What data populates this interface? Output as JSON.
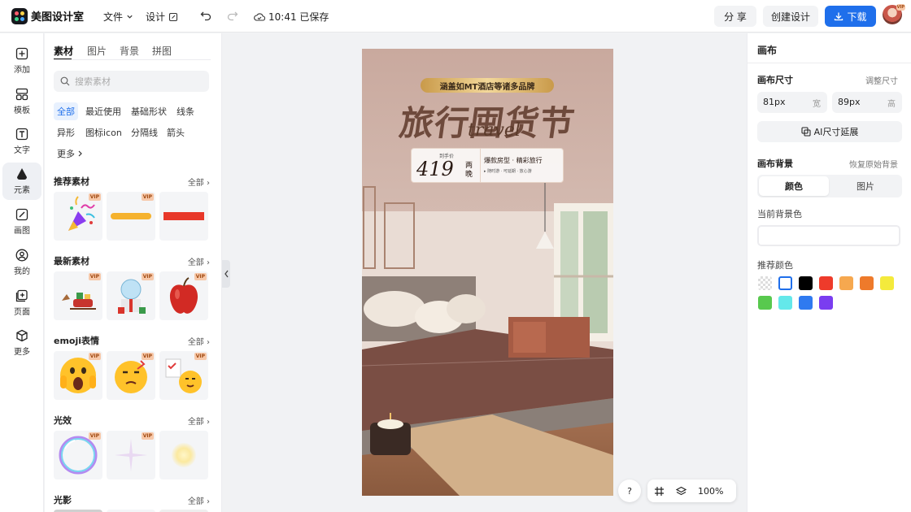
{
  "header": {
    "app_name": "美图设计室",
    "menu_file": "文件",
    "menu_design": "设计",
    "save_status": "10:41 已保存",
    "share_label": "分 享",
    "create_label": "创建设计",
    "download_label": "下载",
    "avatar_badge": "VIP",
    "accent": "#1f6feb"
  },
  "sidebar": {
    "items": [
      {
        "label": "添加",
        "icon": "plus-square-icon"
      },
      {
        "label": "模板",
        "icon": "template-icon"
      },
      {
        "label": "文字",
        "icon": "text-icon"
      },
      {
        "label": "元素",
        "icon": "shapes-icon"
      },
      {
        "label": "画图",
        "icon": "draw-icon"
      },
      {
        "label": "我的",
        "icon": "user-icon"
      },
      {
        "label": "页面",
        "icon": "page-add-icon"
      },
      {
        "label": "更多",
        "icon": "cube-icon"
      }
    ]
  },
  "panel": {
    "tabs": [
      "素材",
      "图片",
      "背景",
      "拼图"
    ],
    "search_placeholder": "搜索素材",
    "chips": [
      "全部",
      "最近使用",
      "基础形状",
      "线条",
      "异形",
      "图标icon",
      "分隔线",
      "箭头",
      "更多"
    ],
    "all_label": "全部",
    "vip_label": "VIP",
    "sections": [
      "推荐素材",
      "最新素材",
      "emoji表情",
      "光效",
      "光影"
    ]
  },
  "poster": {
    "banner": "涵盖如MT酒店等诸多品牌",
    "title": "旅行囤货节",
    "script_word": "travel",
    "price_prefix": "到手价",
    "price": "419",
    "price_unit_1": "两",
    "price_unit_2": "晚",
    "slogan": "爆款房型 · 精彩旅行",
    "slogan_sub": "▸ 随时游 · 可延期 · 放心游"
  },
  "right_panel": {
    "title": "画布",
    "size_label": "画布尺寸",
    "adjust_label": "调整尺寸",
    "width_value": "81px",
    "width_unit": "宽",
    "height_value": "89px",
    "height_unit": "高",
    "ai_extend_label": "AI尺寸延展",
    "bg_label": "画布背景",
    "restore_label": "恢复原始背景",
    "seg_color": "颜色",
    "seg_image": "图片",
    "current_bg_label": "当前背景色",
    "recommend_label": "推荐颜色",
    "colors": [
      "transparent",
      "#ffffff",
      "#000000",
      "#ee3b2b",
      "#f6a84f",
      "#ee7a2b",
      "#f4ea3c",
      "#58c94e",
      "#64e8ea",
      "#2f7af0",
      "#7a3df0"
    ]
  },
  "zoom": {
    "help": "?",
    "value": "100%"
  }
}
